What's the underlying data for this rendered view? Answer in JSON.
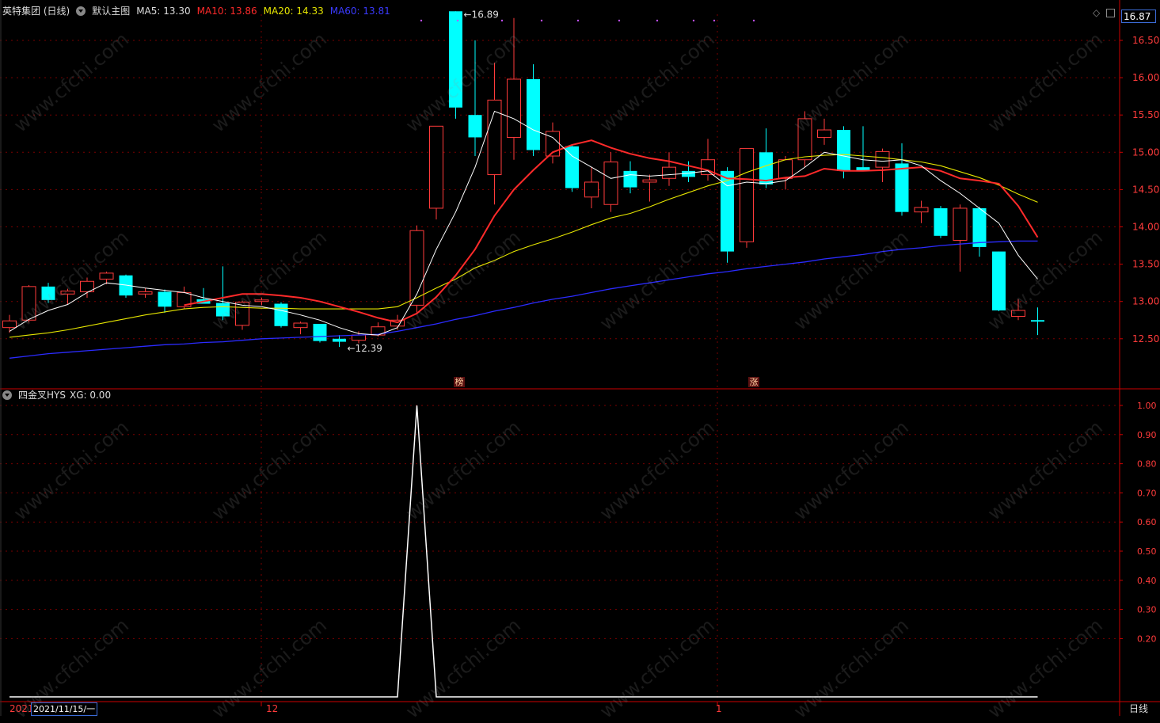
{
  "header": {
    "stock_label": "英特集团 (日线)",
    "template_label": "默认主图",
    "ma5": "MA5: 13.30",
    "ma10": "MA10: 13.86",
    "ma20": "MA20: 14.33",
    "ma60": "MA60: 13.81"
  },
  "indicator_header": {
    "name": "四金叉HYS",
    "xg": "XG: 0.00"
  },
  "price_tag": "16.87",
  "bottom": {
    "year": "2021",
    "date_box": "2021/11/15/一",
    "month_12": "12",
    "month_1": "1",
    "period": "日线"
  },
  "markers": {
    "bang": "榜",
    "zhang": "涨"
  },
  "colors": {
    "up": "#ff3b3b",
    "down": "#00ffff",
    "ma5": "#ffffff",
    "ma10": "#ff2a2a",
    "ma20": "#e6e600",
    "ma60": "#2b2bff",
    "grid": "#7a0000",
    "axis": "#cc0000",
    "axis_text": "#ff3b3b"
  },
  "chart_data": [
    {
      "type": "candlestick",
      "title": "英特集团 (日线)",
      "ylim": [
        12.2,
        16.95
      ],
      "y_ticks": [
        "12.50",
        "13.00",
        "13.50",
        "14.00",
        "14.50",
        "15.00",
        "15.50",
        "16.00",
        "16.50"
      ],
      "annotations": [
        {
          "label": "16.89",
          "candle": 23
        },
        {
          "label": "12.39",
          "candle": 17
        }
      ],
      "candles": [
        {
          "o": 12.65,
          "h": 12.82,
          "l": 12.58,
          "c": 12.74
        },
        {
          "o": 12.75,
          "h": 13.22,
          "l": 12.72,
          "c": 13.2
        },
        {
          "o": 13.2,
          "h": 13.25,
          "l": 12.98,
          "c": 13.02
        },
        {
          "o": 13.1,
          "h": 13.17,
          "l": 12.96,
          "c": 13.14
        },
        {
          "o": 13.13,
          "h": 13.32,
          "l": 13.05,
          "c": 13.27
        },
        {
          "o": 13.3,
          "h": 13.4,
          "l": 13.23,
          "c": 13.38
        },
        {
          "o": 13.35,
          "h": 13.36,
          "l": 13.05,
          "c": 13.08
        },
        {
          "o": 13.1,
          "h": 13.18,
          "l": 13.05,
          "c": 13.13
        },
        {
          "o": 13.13,
          "h": 13.16,
          "l": 12.85,
          "c": 12.93
        },
        {
          "o": 12.93,
          "h": 13.2,
          "l": 12.9,
          "c": 13.12
        },
        {
          "o": 13.03,
          "h": 13.18,
          "l": 12.98,
          "c": 12.97
        },
        {
          "o": 12.98,
          "h": 13.47,
          "l": 12.75,
          "c": 12.8
        },
        {
          "o": 12.68,
          "h": 13.01,
          "l": 12.62,
          "c": 12.99
        },
        {
          "o": 13.0,
          "h": 13.05,
          "l": 12.95,
          "c": 13.02
        },
        {
          "o": 12.97,
          "h": 12.99,
          "l": 12.65,
          "c": 12.67
        },
        {
          "o": 12.65,
          "h": 12.73,
          "l": 12.56,
          "c": 12.71
        },
        {
          "o": 12.7,
          "h": 12.7,
          "l": 12.45,
          "c": 12.47
        },
        {
          "o": 12.5,
          "h": 12.55,
          "l": 12.39,
          "c": 12.46
        },
        {
          "o": 12.48,
          "h": 12.6,
          "l": 12.44,
          "c": 12.55
        },
        {
          "o": 12.55,
          "h": 12.72,
          "l": 12.53,
          "c": 12.66
        },
        {
          "o": 12.67,
          "h": 12.82,
          "l": 12.62,
          "c": 12.75
        },
        {
          "o": 12.95,
          "h": 14.02,
          "l": 12.85,
          "c": 13.95
        },
        {
          "o": 14.25,
          "h": 15.35,
          "l": 14.1,
          "c": 15.35
        },
        {
          "o": 16.89,
          "h": 16.89,
          "l": 15.45,
          "c": 15.6
        },
        {
          "o": 15.5,
          "h": 16.5,
          "l": 14.95,
          "c": 15.2
        },
        {
          "o": 14.7,
          "h": 16.2,
          "l": 14.3,
          "c": 15.7
        },
        {
          "o": 15.2,
          "h": 16.8,
          "l": 14.9,
          "c": 15.98
        },
        {
          "o": 15.98,
          "h": 16.18,
          "l": 14.95,
          "c": 15.03
        },
        {
          "o": 14.95,
          "h": 15.4,
          "l": 14.85,
          "c": 15.28
        },
        {
          "o": 15.08,
          "h": 15.1,
          "l": 14.47,
          "c": 14.52
        },
        {
          "o": 14.4,
          "h": 14.8,
          "l": 14.25,
          "c": 14.6
        },
        {
          "o": 14.3,
          "h": 15.0,
          "l": 14.2,
          "c": 14.87
        },
        {
          "o": 14.75,
          "h": 14.88,
          "l": 14.45,
          "c": 14.53
        },
        {
          "o": 14.6,
          "h": 14.7,
          "l": 14.34,
          "c": 14.63
        },
        {
          "o": 14.65,
          "h": 15.0,
          "l": 14.55,
          "c": 14.8
        },
        {
          "o": 14.75,
          "h": 14.88,
          "l": 14.6,
          "c": 14.67
        },
        {
          "o": 14.7,
          "h": 15.18,
          "l": 14.62,
          "c": 14.9
        },
        {
          "o": 14.75,
          "h": 14.8,
          "l": 13.52,
          "c": 13.67
        },
        {
          "o": 13.8,
          "h": 15.05,
          "l": 13.72,
          "c": 15.05
        },
        {
          "o": 15.0,
          "h": 15.32,
          "l": 14.52,
          "c": 14.57
        },
        {
          "o": 14.65,
          "h": 14.95,
          "l": 14.5,
          "c": 14.9
        },
        {
          "o": 14.9,
          "h": 15.55,
          "l": 14.8,
          "c": 15.45
        },
        {
          "o": 15.2,
          "h": 15.45,
          "l": 15.1,
          "c": 15.3
        },
        {
          "o": 15.3,
          "h": 15.35,
          "l": 14.65,
          "c": 14.75
        },
        {
          "o": 14.8,
          "h": 15.35,
          "l": 14.75,
          "c": 14.75
        },
        {
          "o": 14.8,
          "h": 15.05,
          "l": 14.6,
          "c": 15.01
        },
        {
          "o": 14.85,
          "h": 15.12,
          "l": 14.15,
          "c": 14.2
        },
        {
          "o": 14.2,
          "h": 14.35,
          "l": 14.05,
          "c": 14.26
        },
        {
          "o": 14.25,
          "h": 14.28,
          "l": 13.85,
          "c": 13.88
        },
        {
          "o": 13.82,
          "h": 14.3,
          "l": 13.4,
          "c": 14.25
        },
        {
          "o": 14.25,
          "h": 14.27,
          "l": 13.6,
          "c": 13.73
        },
        {
          "o": 13.67,
          "h": 13.67,
          "l": 12.87,
          "c": 12.88
        },
        {
          "o": 12.8,
          "h": 13.03,
          "l": 12.75,
          "c": 12.88
        },
        {
          "o": 12.75,
          "h": 12.92,
          "l": 12.55,
          "c": 12.73
        }
      ],
      "ma5": [
        12.6,
        12.76,
        12.88,
        12.96,
        13.12,
        13.25,
        13.22,
        13.18,
        13.15,
        13.12,
        13.05,
        13.0,
        12.95,
        12.93,
        12.88,
        12.82,
        12.75,
        12.65,
        12.57,
        12.55,
        12.65,
        13.1,
        13.7,
        14.2,
        14.8,
        15.55,
        15.45,
        15.3,
        15.2,
        14.95,
        14.8,
        14.65,
        14.7,
        14.68,
        14.7,
        14.72,
        14.75,
        14.55,
        14.6,
        14.58,
        14.62,
        14.8,
        15.0,
        14.95,
        14.9,
        14.88,
        14.9,
        14.82,
        14.62,
        14.45,
        14.25,
        14.05,
        13.62,
        13.3
      ],
      "ma10": [
        null,
        null,
        null,
        null,
        null,
        null,
        null,
        null,
        null,
        12.95,
        13.0,
        13.05,
        13.1,
        13.1,
        13.08,
        13.05,
        13.0,
        12.93,
        12.86,
        12.78,
        12.72,
        12.84,
        13.06,
        13.35,
        13.7,
        14.15,
        14.5,
        14.76,
        15.0,
        15.1,
        15.16,
        15.06,
        14.98,
        14.92,
        14.88,
        14.82,
        14.76,
        14.65,
        14.64,
        14.62,
        14.66,
        14.68,
        14.78,
        14.75,
        14.75,
        14.76,
        14.78,
        14.8,
        14.75,
        14.65,
        14.62,
        14.58,
        14.28,
        13.86
      ],
      "ma20": [
        12.52,
        12.55,
        12.58,
        12.62,
        12.67,
        12.72,
        12.77,
        12.82,
        12.86,
        12.9,
        12.92,
        12.93,
        12.92,
        12.91,
        12.91,
        12.9,
        12.9,
        12.9,
        12.9,
        12.9,
        12.93,
        13.05,
        13.18,
        13.3,
        13.45,
        13.55,
        13.67,
        13.76,
        13.84,
        13.93,
        14.03,
        14.12,
        14.18,
        14.27,
        14.37,
        14.46,
        14.55,
        14.62,
        14.73,
        14.82,
        14.9,
        14.94,
        14.96,
        14.97,
        14.95,
        14.93,
        14.9,
        14.87,
        14.82,
        14.74,
        14.66,
        14.56,
        14.44,
        14.33
      ],
      "ma60": [
        12.24,
        12.27,
        12.3,
        12.32,
        12.34,
        12.36,
        12.38,
        12.4,
        12.42,
        12.43,
        12.45,
        12.46,
        12.48,
        12.5,
        12.51,
        12.52,
        12.53,
        12.54,
        12.55,
        12.56,
        12.6,
        12.65,
        12.7,
        12.76,
        12.81,
        12.87,
        12.92,
        12.98,
        13.03,
        13.07,
        13.12,
        13.17,
        13.21,
        13.25,
        13.29,
        13.33,
        13.37,
        13.4,
        13.44,
        13.47,
        13.5,
        13.53,
        13.57,
        13.6,
        13.63,
        13.67,
        13.7,
        13.72,
        13.75,
        13.77,
        13.79,
        13.8,
        13.81,
        13.81
      ]
    },
    {
      "type": "line",
      "title": "四金叉HYS",
      "ylim": [
        0,
        1.05
      ],
      "y_ticks": [
        "0.20",
        "0.30",
        "0.40",
        "0.50",
        "0.60",
        "0.70",
        "0.80",
        "0.90",
        "1.00"
      ],
      "series": [
        {
          "name": "XG",
          "values": [
            0,
            0,
            0,
            0,
            0,
            0,
            0,
            0,
            0,
            0,
            0,
            0,
            0,
            0,
            0,
            0,
            0,
            0,
            0,
            0,
            0,
            1,
            0,
            0,
            0,
            0,
            0,
            0,
            0,
            0,
            0,
            0,
            0,
            0,
            0,
            0,
            0,
            0,
            0,
            0,
            0,
            0,
            0,
            0,
            0,
            0,
            0,
            0,
            0,
            0,
            0,
            0,
            0,
            0
          ]
        }
      ]
    }
  ]
}
